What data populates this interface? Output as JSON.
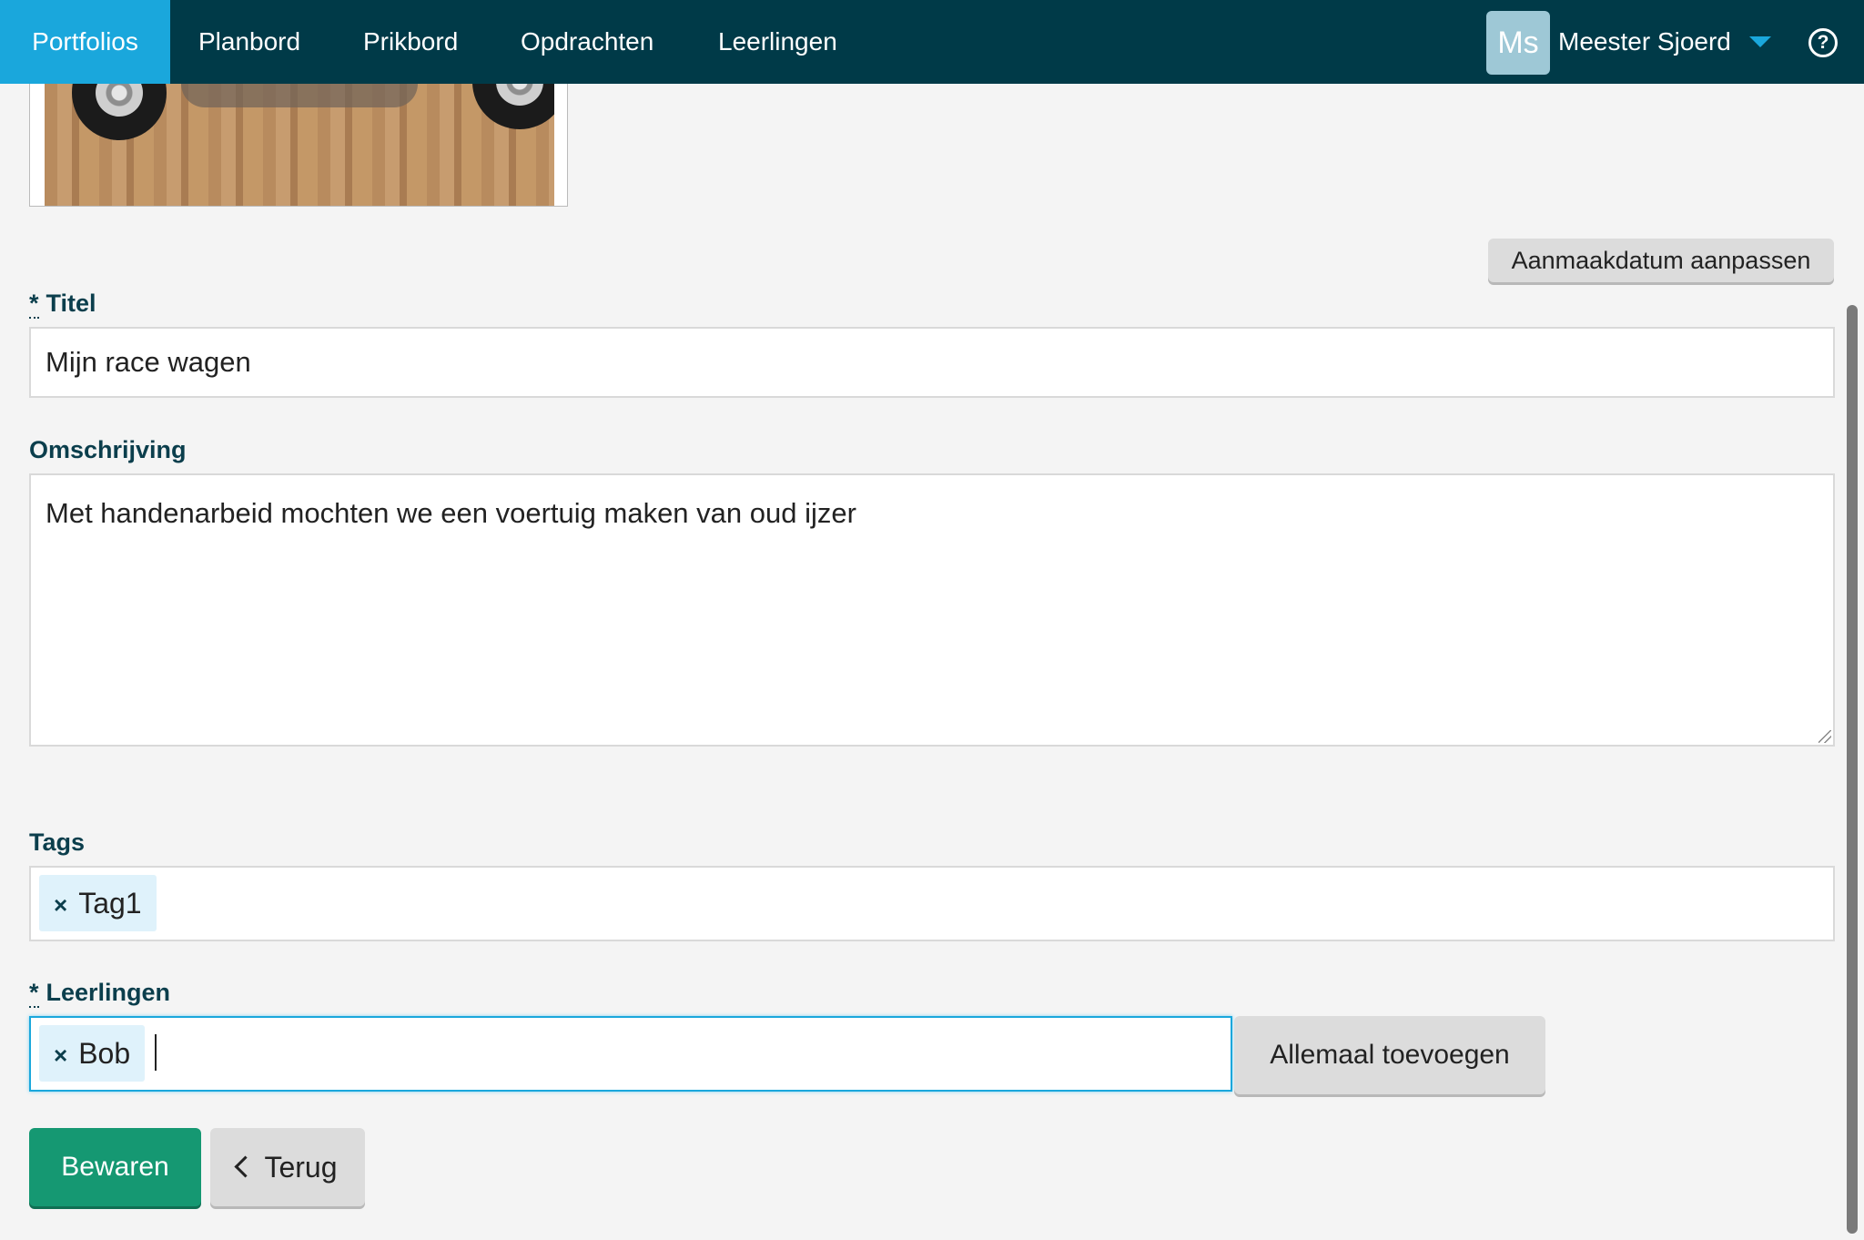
{
  "nav": {
    "items": [
      {
        "label": "Portfolios",
        "active": true
      },
      {
        "label": "Planbord",
        "active": false
      },
      {
        "label": "Prikbord",
        "active": false
      },
      {
        "label": "Opdrachten",
        "active": false
      },
      {
        "label": "Leerlingen",
        "active": false
      }
    ],
    "user": {
      "initials": "Ms",
      "name": "Meester Sjoerd"
    },
    "help_icon": "question-circle-icon"
  },
  "form": {
    "date_button": "Aanmaakdatum aanpassen",
    "title": {
      "required_mark": "*",
      "label": "Titel",
      "value": "Mijn race wagen"
    },
    "description": {
      "label": "Omschrijving",
      "value": "Met handenarbeid mochten we een voertuig maken van oud ijzer"
    },
    "tags": {
      "label": "Tags",
      "chips": [
        "Tag1"
      ]
    },
    "students": {
      "required_mark": "*",
      "label": "Leerlingen",
      "chips": [
        "Bob"
      ],
      "add_all_button": "Allemaal toevoegen"
    },
    "remove_glyph": "×",
    "save_button": "Bewaren",
    "back_button": "Terug"
  },
  "colors": {
    "nav_bg": "#003a48",
    "nav_active": "#1aa7dc",
    "save_green": "#159872",
    "label_color": "#0b3e4c",
    "chip_bg": "#dff2fb"
  }
}
